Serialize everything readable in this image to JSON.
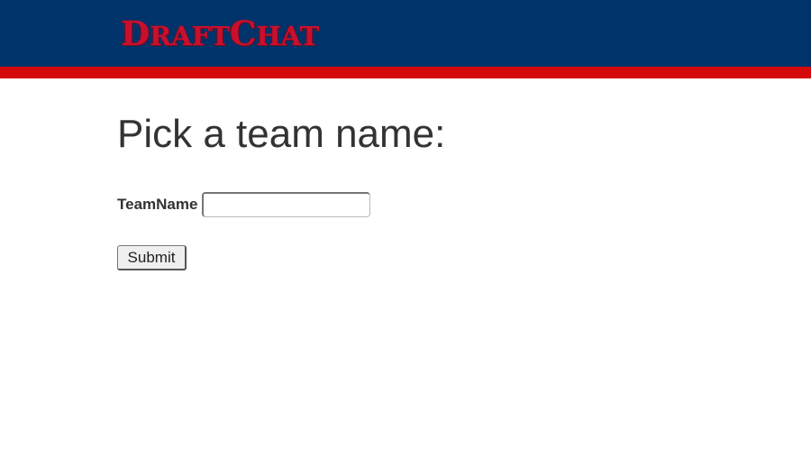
{
  "header": {
    "logo_first": "D",
    "logo_first_rest": "RAFT",
    "logo_second": "C",
    "logo_second_rest": "HAT",
    "background_color": "#00336a",
    "stripe_color": "#d50a0a",
    "logo_color": "#c8102e"
  },
  "main": {
    "title": "Pick a team name:",
    "form": {
      "team_name_label": "TeamName",
      "team_name_value": "",
      "submit_label": "Submit"
    }
  }
}
